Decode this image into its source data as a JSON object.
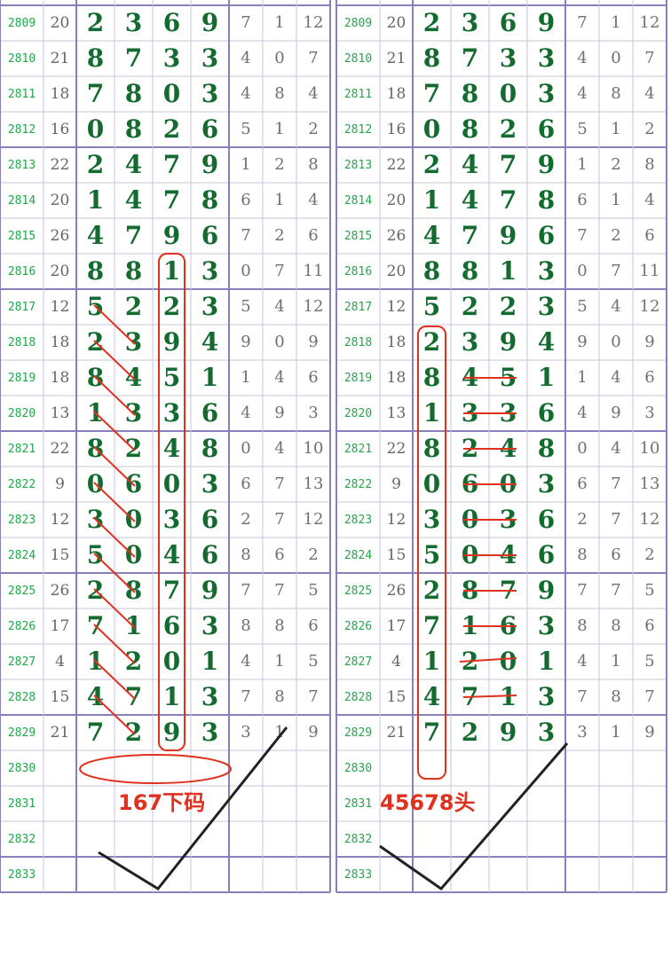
{
  "colors": {
    "grid_line": "#c9c6de",
    "grid_major": "#8a80b8",
    "issue_text": "#22a84a",
    "sum_text": "#666666",
    "main_digit": "#146b2f",
    "small_digit": "#707070",
    "annotation_red": "#e0301e",
    "check_mark": "#222222"
  },
  "panels": [
    {
      "rows": [
        {
          "issue": "2809",
          "sum": "20",
          "main": [
            "2",
            "3",
            "6",
            "9"
          ],
          "small": [
            "7",
            "1",
            "12"
          ]
        },
        {
          "issue": "2810",
          "sum": "21",
          "main": [
            "8",
            "7",
            "3",
            "3"
          ],
          "small": [
            "4",
            "0",
            "7"
          ]
        },
        {
          "issue": "2811",
          "sum": "18",
          "main": [
            "7",
            "8",
            "0",
            "3"
          ],
          "small": [
            "4",
            "8",
            "4"
          ]
        },
        {
          "issue": "2812",
          "sum": "16",
          "main": [
            "0",
            "8",
            "2",
            "6"
          ],
          "small": [
            "5",
            "1",
            "2"
          ]
        },
        {
          "issue": "2813",
          "sum": "22",
          "main": [
            "2",
            "4",
            "7",
            "9"
          ],
          "small": [
            "1",
            "2",
            "8"
          ]
        },
        {
          "issue": "2814",
          "sum": "20",
          "main": [
            "1",
            "4",
            "7",
            "8"
          ],
          "small": [
            "6",
            "1",
            "4"
          ]
        },
        {
          "issue": "2815",
          "sum": "26",
          "main": [
            "4",
            "7",
            "9",
            "6"
          ],
          "small": [
            "7",
            "2",
            "6"
          ]
        },
        {
          "issue": "2816",
          "sum": "20",
          "main": [
            "8",
            "8",
            "1",
            "3"
          ],
          "small": [
            "0",
            "7",
            "11"
          ]
        },
        {
          "issue": "2817",
          "sum": "12",
          "main": [
            "5",
            "2",
            "2",
            "3"
          ],
          "small": [
            "5",
            "4",
            "12"
          ]
        },
        {
          "issue": "2818",
          "sum": "18",
          "main": [
            "2",
            "3",
            "9",
            "4"
          ],
          "small": [
            "9",
            "0",
            "9"
          ]
        },
        {
          "issue": "2819",
          "sum": "18",
          "main": [
            "8",
            "4",
            "5",
            "1"
          ],
          "small": [
            "1",
            "4",
            "6"
          ]
        },
        {
          "issue": "2820",
          "sum": "13",
          "main": [
            "1",
            "3",
            "3",
            "6"
          ],
          "small": [
            "4",
            "9",
            "3"
          ]
        },
        {
          "issue": "2821",
          "sum": "22",
          "main": [
            "8",
            "2",
            "4",
            "8"
          ],
          "small": [
            "0",
            "4",
            "10"
          ]
        },
        {
          "issue": "2822",
          "sum": "9",
          "main": [
            "0",
            "6",
            "0",
            "3"
          ],
          "small": [
            "6",
            "7",
            "13"
          ]
        },
        {
          "issue": "2823",
          "sum": "12",
          "main": [
            "3",
            "0",
            "3",
            "6"
          ],
          "small": [
            "2",
            "7",
            "12"
          ]
        },
        {
          "issue": "2824",
          "sum": "15",
          "main": [
            "5",
            "0",
            "4",
            "6"
          ],
          "small": [
            "8",
            "6",
            "2"
          ]
        },
        {
          "issue": "2825",
          "sum": "26",
          "main": [
            "2",
            "8",
            "7",
            "9"
          ],
          "small": [
            "7",
            "7",
            "5"
          ]
        },
        {
          "issue": "2826",
          "sum": "17",
          "main": [
            "7",
            "1",
            "6",
            "3"
          ],
          "small": [
            "8",
            "8",
            "6"
          ]
        },
        {
          "issue": "2827",
          "sum": "4",
          "main": [
            "1",
            "2",
            "0",
            "1"
          ],
          "small": [
            "4",
            "1",
            "5"
          ]
        },
        {
          "issue": "2828",
          "sum": "15",
          "main": [
            "4",
            "7",
            "1",
            "3"
          ],
          "small": [
            "7",
            "8",
            "7"
          ]
        },
        {
          "issue": "2829",
          "sum": "21",
          "main": [
            "7",
            "2",
            "9",
            "3"
          ],
          "small": [
            "3",
            "1",
            "9"
          ]
        },
        {
          "issue": "2830",
          "sum": "",
          "main": [
            "",
            "",
            "",
            ""
          ],
          "small": [
            "",
            "",
            ""
          ]
        },
        {
          "issue": "2831",
          "sum": "",
          "main": [
            "",
            "",
            "",
            ""
          ],
          "small": [
            "",
            "",
            ""
          ]
        },
        {
          "issue": "2832",
          "sum": "",
          "main": [
            "",
            "",
            "",
            ""
          ],
          "small": [
            "",
            "",
            ""
          ]
        },
        {
          "issue": "2833",
          "sum": "",
          "main": [
            "",
            "",
            "",
            ""
          ],
          "small": [
            "",
            "",
            ""
          ]
        }
      ],
      "annotation": "167下码"
    },
    {
      "rows": [
        {
          "issue": "2809",
          "sum": "20",
          "main": [
            "2",
            "3",
            "6",
            "9"
          ],
          "small": [
            "7",
            "1",
            "12"
          ]
        },
        {
          "issue": "2810",
          "sum": "21",
          "main": [
            "8",
            "7",
            "3",
            "3"
          ],
          "small": [
            "4",
            "0",
            "7"
          ]
        },
        {
          "issue": "2811",
          "sum": "18",
          "main": [
            "7",
            "8",
            "0",
            "3"
          ],
          "small": [
            "4",
            "8",
            "4"
          ]
        },
        {
          "issue": "2812",
          "sum": "16",
          "main": [
            "0",
            "8",
            "2",
            "6"
          ],
          "small": [
            "5",
            "1",
            "2"
          ]
        },
        {
          "issue": "2813",
          "sum": "22",
          "main": [
            "2",
            "4",
            "7",
            "9"
          ],
          "small": [
            "1",
            "2",
            "8"
          ]
        },
        {
          "issue": "2814",
          "sum": "20",
          "main": [
            "1",
            "4",
            "7",
            "8"
          ],
          "small": [
            "6",
            "1",
            "4"
          ]
        },
        {
          "issue": "2815",
          "sum": "26",
          "main": [
            "4",
            "7",
            "9",
            "6"
          ],
          "small": [
            "7",
            "2",
            "6"
          ]
        },
        {
          "issue": "2816",
          "sum": "20",
          "main": [
            "8",
            "8",
            "1",
            "3"
          ],
          "small": [
            "0",
            "7",
            "11"
          ]
        },
        {
          "issue": "2817",
          "sum": "12",
          "main": [
            "5",
            "2",
            "2",
            "3"
          ],
          "small": [
            "5",
            "4",
            "12"
          ]
        },
        {
          "issue": "2818",
          "sum": "18",
          "main": [
            "2",
            "3",
            "9",
            "4"
          ],
          "small": [
            "9",
            "0",
            "9"
          ]
        },
        {
          "issue": "2819",
          "sum": "18",
          "main": [
            "8",
            "4",
            "5",
            "1"
          ],
          "small": [
            "1",
            "4",
            "6"
          ]
        },
        {
          "issue": "2820",
          "sum": "13",
          "main": [
            "1",
            "3",
            "3",
            "6"
          ],
          "small": [
            "4",
            "9",
            "3"
          ]
        },
        {
          "issue": "2821",
          "sum": "22",
          "main": [
            "8",
            "2",
            "4",
            "8"
          ],
          "small": [
            "0",
            "4",
            "10"
          ]
        },
        {
          "issue": "2822",
          "sum": "9",
          "main": [
            "0",
            "6",
            "0",
            "3"
          ],
          "small": [
            "6",
            "7",
            "13"
          ]
        },
        {
          "issue": "2823",
          "sum": "12",
          "main": [
            "3",
            "0",
            "3",
            "6"
          ],
          "small": [
            "2",
            "7",
            "12"
          ]
        },
        {
          "issue": "2824",
          "sum": "15",
          "main": [
            "5",
            "0",
            "4",
            "6"
          ],
          "small": [
            "8",
            "6",
            "2"
          ]
        },
        {
          "issue": "2825",
          "sum": "26",
          "main": [
            "2",
            "8",
            "7",
            "9"
          ],
          "small": [
            "7",
            "7",
            "5"
          ]
        },
        {
          "issue": "2826",
          "sum": "17",
          "main": [
            "7",
            "1",
            "6",
            "3"
          ],
          "small": [
            "8",
            "8",
            "6"
          ]
        },
        {
          "issue": "2827",
          "sum": "4",
          "main": [
            "1",
            "2",
            "0",
            "1"
          ],
          "small": [
            "4",
            "1",
            "5"
          ]
        },
        {
          "issue": "2828",
          "sum": "15",
          "main": [
            "4",
            "7",
            "1",
            "3"
          ],
          "small": [
            "7",
            "8",
            "7"
          ]
        },
        {
          "issue": "2829",
          "sum": "21",
          "main": [
            "7",
            "2",
            "9",
            "3"
          ],
          "small": [
            "3",
            "1",
            "9"
          ]
        },
        {
          "issue": "2830",
          "sum": "",
          "main": [
            "",
            "",
            "",
            ""
          ],
          "small": [
            "",
            "",
            ""
          ]
        },
        {
          "issue": "2831",
          "sum": "",
          "main": [
            "",
            "",
            "",
            ""
          ],
          "small": [
            "",
            "",
            ""
          ]
        },
        {
          "issue": "2832",
          "sum": "",
          "main": [
            "",
            "",
            "",
            ""
          ],
          "small": [
            "",
            "",
            ""
          ]
        },
        {
          "issue": "2833",
          "sum": "",
          "main": [
            "",
            "",
            "",
            ""
          ],
          "small": [
            "",
            "",
            ""
          ]
        }
      ],
      "annotation": "45678头"
    }
  ]
}
